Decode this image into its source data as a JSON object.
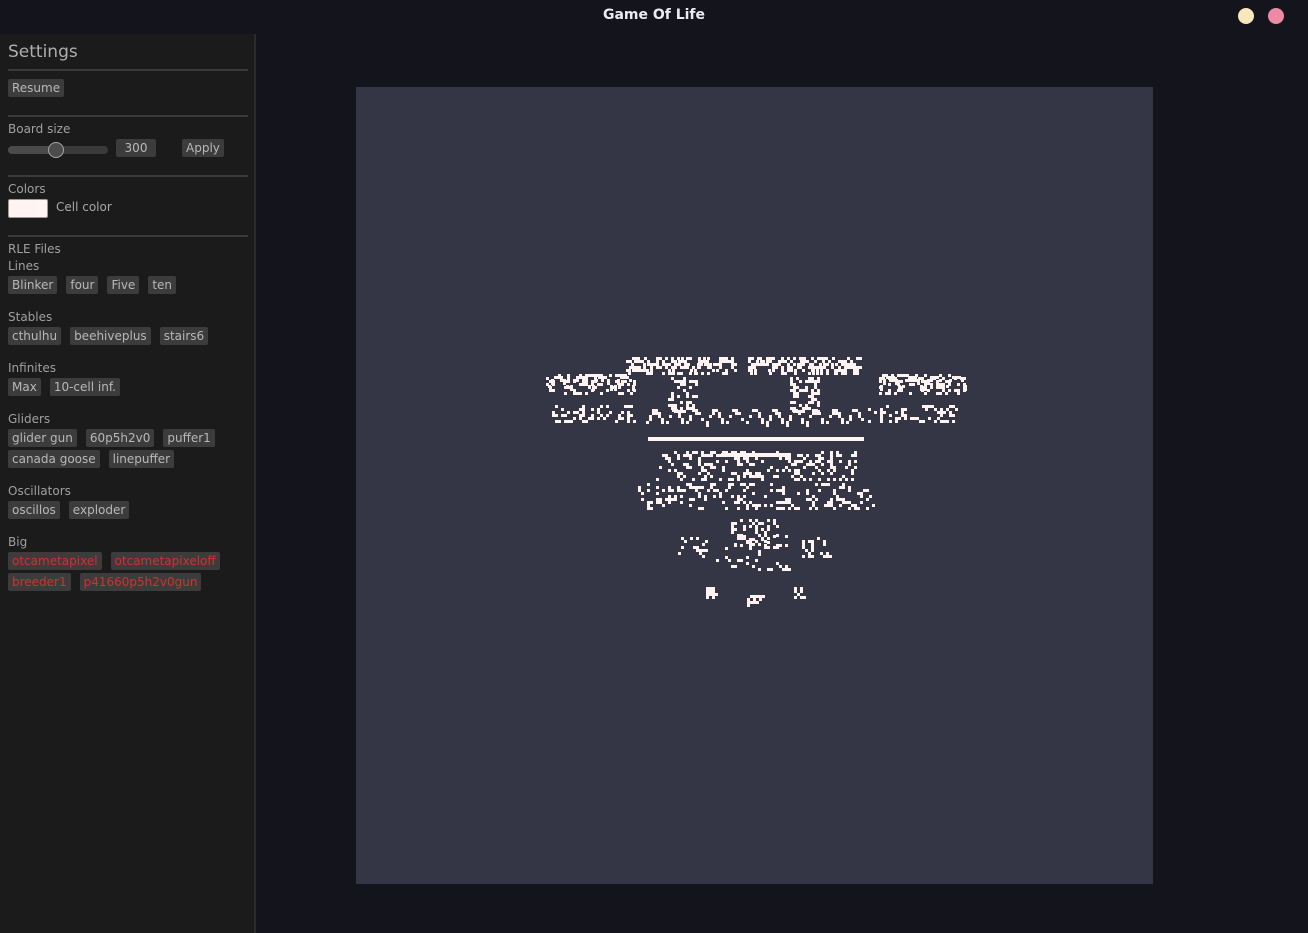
{
  "window": {
    "title": "Game Of Life"
  },
  "settings": {
    "title": "Settings",
    "resume_label": "Resume",
    "board_size": {
      "label": "Board size",
      "value": "300",
      "slider_fraction": 0.48,
      "apply_label": "Apply"
    },
    "colors": {
      "label": "Colors",
      "cell_color_label": "Cell color",
      "cell_color": "#fff4f2"
    },
    "rle": {
      "label": "RLE Files",
      "groups": [
        {
          "name": "Lines",
          "items": [
            "Blinker",
            "four",
            "Five",
            "ten"
          ]
        },
        {
          "name": "Stables",
          "items": [
            "cthulhu",
            "beehiveplus",
            "stairs6"
          ]
        },
        {
          "name": "Infinites",
          "items": [
            "Max",
            "10-cell inf."
          ]
        },
        {
          "name": "Gliders",
          "items": [
            "glider gun",
            "60p5h2v0",
            "puffer1",
            "canada goose",
            "linepuffer"
          ]
        },
        {
          "name": "Oscillators",
          "items": [
            "oscillos",
            "exploder"
          ]
        },
        {
          "name": "Big",
          "items": [
            "otcametapixel",
            "otcametapixeloff",
            "breeder1",
            "p41660p5h2v0gun"
          ]
        }
      ]
    }
  },
  "colors": {
    "background": "#14141d",
    "panel": "#1b1b1b",
    "board": "#343646",
    "big_item_text": "#d13131",
    "minimize": "#f9e7bb",
    "close": "#ee8aa6"
  }
}
